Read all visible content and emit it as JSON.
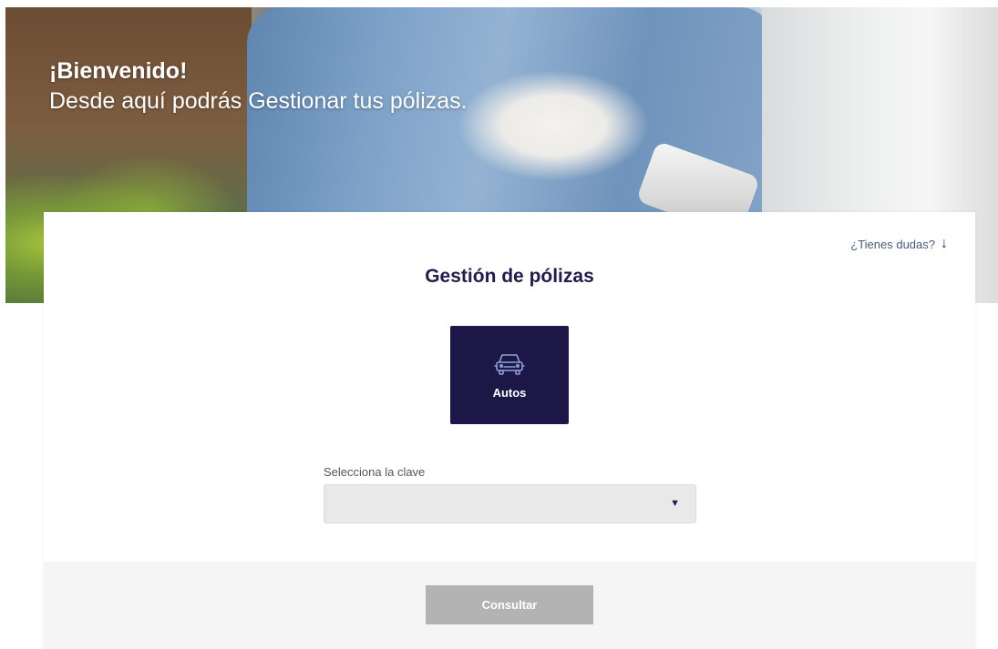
{
  "hero": {
    "title": "¡Bienvenido!",
    "subtitle": "Desde aquí podrás Gestionar tus pólizas."
  },
  "card": {
    "help_link": "¿Tienes dudas?",
    "help_arrow_icon": "arrow-down-icon",
    "title": "Gestión de pólizas",
    "product": {
      "label": "Autos",
      "icon": "car-icon"
    },
    "select": {
      "label": "Selecciona la clave",
      "value": "",
      "caret_icon": "caret-down-icon"
    },
    "submit_label": "Consultar"
  },
  "colors": {
    "brand_dark": "#1c1747",
    "title_text": "#1f1d4a",
    "button_disabled": "#b3b3b3",
    "select_bg": "#e9e9e9",
    "footer_bg": "#f5f5f5"
  }
}
